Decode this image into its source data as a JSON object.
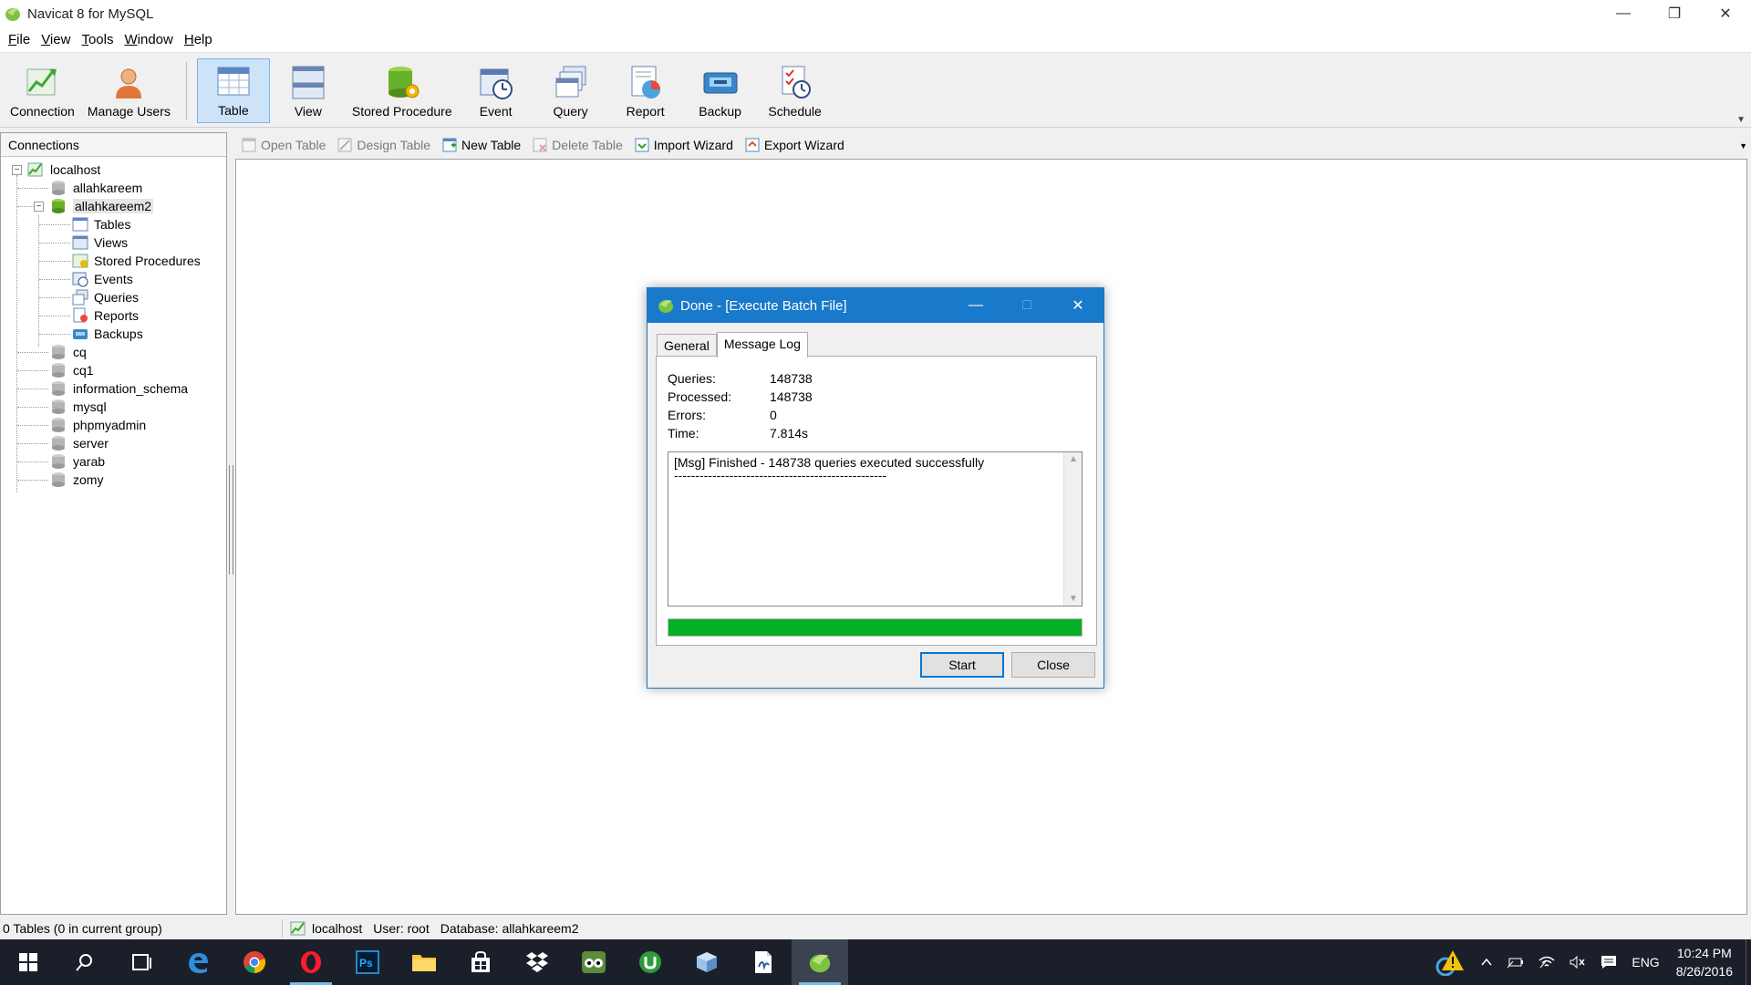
{
  "window": {
    "title": "Navicat 8 for MySQL"
  },
  "menu": [
    "File",
    "View",
    "Tools",
    "Window",
    "Help"
  ],
  "toolbar": [
    {
      "label": "Connection",
      "icon": "connection-icon"
    },
    {
      "label": "Manage Users",
      "icon": "user-icon"
    },
    {
      "label": "Table",
      "icon": "table-icon",
      "active": true
    },
    {
      "label": "View",
      "icon": "view-icon"
    },
    {
      "label": "Stored Procedure",
      "icon": "stored-procedure-icon"
    },
    {
      "label": "Event",
      "icon": "event-icon"
    },
    {
      "label": "Query",
      "icon": "query-icon"
    },
    {
      "label": "Report",
      "icon": "report-icon"
    },
    {
      "label": "Backup",
      "icon": "backup-icon"
    },
    {
      "label": "Schedule",
      "icon": "schedule-icon"
    }
  ],
  "connections": {
    "header": "Connections",
    "server": "localhost",
    "databases": [
      "allahkareem",
      "allahkareem2",
      "cq",
      "cq1",
      "information_schema",
      "mysql",
      "phpmyadmin",
      "server",
      "yarab",
      "zomy"
    ],
    "open_database_children": [
      "Tables",
      "Views",
      "Stored Procedures",
      "Events",
      "Queries",
      "Reports",
      "Backups"
    ]
  },
  "object_toolbar": [
    {
      "label": "Open Table",
      "enabled": false
    },
    {
      "label": "Design Table",
      "enabled": false
    },
    {
      "label": "New Table",
      "enabled": true
    },
    {
      "label": "Delete Table",
      "enabled": false
    },
    {
      "label": "Import Wizard",
      "enabled": true
    },
    {
      "label": "Export Wizard",
      "enabled": true
    }
  ],
  "status": {
    "tables": "0 Tables (0 in current group)",
    "server": "localhost",
    "user": "User: root",
    "database": "Database: allahkareem2"
  },
  "dialog": {
    "title": "Done - [Execute Batch File]",
    "tabs": [
      "General",
      "Message Log"
    ],
    "selected_tab": "Message Log",
    "stats": [
      {
        "label": "Queries:",
        "value": "148738"
      },
      {
        "label": "Processed:",
        "value": "148738"
      },
      {
        "label": "Errors:",
        "value": "0"
      },
      {
        "label": "Time:",
        "value": "7.814s"
      }
    ],
    "log_line1": "[Msg] Finished - 148738 queries executed successfully",
    "log_line2": "--------------------------------------------------",
    "progress_percent": 100,
    "progress_color": "#06b025",
    "start_label": "Start",
    "close_label": "Close"
  },
  "tray": {
    "language": "ENG",
    "time": "10:24 PM",
    "date": "8/26/2016"
  },
  "colors": {
    "accent": "#1979ca",
    "selection": "#cde3f7"
  }
}
